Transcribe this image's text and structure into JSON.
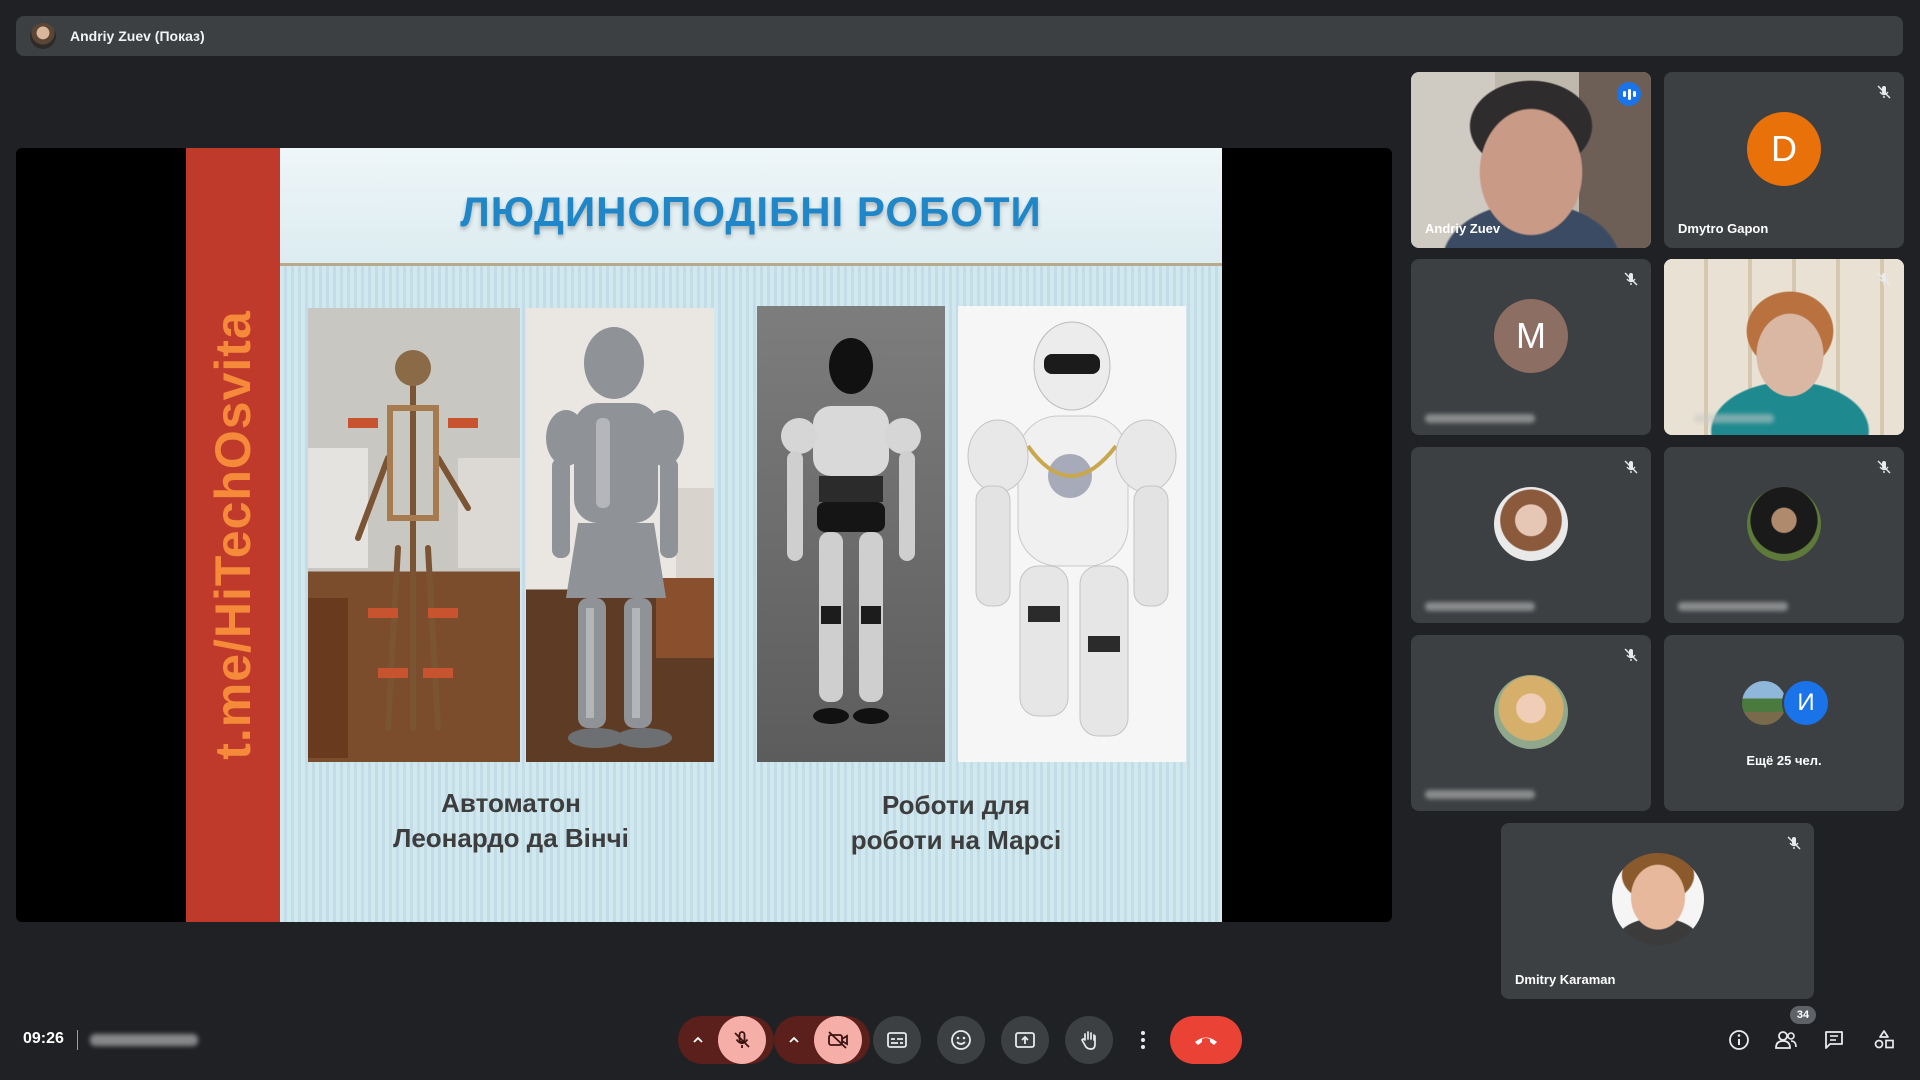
{
  "presenter_bar": {
    "name": "Andriy Zuev (Показ)"
  },
  "slide": {
    "side_text": "t.me/HiTechOsvita",
    "title": "ЛЮДИНОПОДІБНІ РОБОТИ",
    "caption_left_line1": "Автоматон",
    "caption_left_line2": "Леонардо да Вінчі",
    "caption_right_line1": "Роботи для",
    "caption_right_line2": "роботи на Марсі"
  },
  "participants": [
    {
      "name": "Andriy Zuev",
      "state": "speaking"
    },
    {
      "name": "Dmytro Gapon",
      "initial": "D",
      "avatar_color": "#e8710a",
      "state": "muted"
    },
    {
      "initial": "M",
      "avatar_color": "#8d6e63",
      "state": "muted"
    },
    {
      "state": "muted"
    },
    {
      "state": "muted"
    },
    {
      "state": "muted"
    },
    {
      "state": "muted"
    },
    {
      "more_initial": "И",
      "more_label": "Ещё 25 чел."
    },
    {
      "name": "Dmitry Karaman",
      "state": "muted"
    }
  ],
  "bottom_bar": {
    "time": "09:26",
    "people_count": "34",
    "controls": [
      "mic-off",
      "camera-off",
      "captions",
      "emoji",
      "present",
      "raise-hand",
      "more",
      "end-call"
    ],
    "accent_end": "#ea4335",
    "accent_muted": "#f6aea9"
  }
}
